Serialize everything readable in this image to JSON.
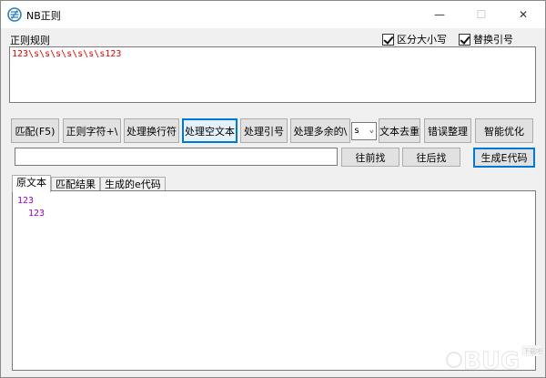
{
  "window": {
    "title": "NB正则",
    "min_glyph": "—",
    "max_glyph": "☐",
    "close_glyph": "✕"
  },
  "rule": {
    "label": "正则规则",
    "case_label": "区分大小写",
    "case_checked": true,
    "quote_label": "替换引号",
    "quote_checked": true,
    "value": "123\\s\\s\\s\\s\\s\\s\\s123"
  },
  "toolbar": {
    "match": "匹配(F5)",
    "regex_char": "正则字符+\\",
    "newline": "处理换行符",
    "empty_text": "处理空文本",
    "quotes": "处理引号",
    "extra": "处理多余的\\",
    "select_value": "s",
    "dedupe": "文本去重",
    "error_fix": "错误整理",
    "smart": "智能优化"
  },
  "find": {
    "value": "",
    "prev": "往前找",
    "next": "往后找",
    "generate": "生成E代码"
  },
  "tabs": [
    "原文本",
    "匹配结果",
    "生成的e代码"
  ],
  "source_text": {
    "line1": "123",
    "line2": "123"
  },
  "watermark": {
    "text": "BUG",
    "sub": "下载吧"
  }
}
